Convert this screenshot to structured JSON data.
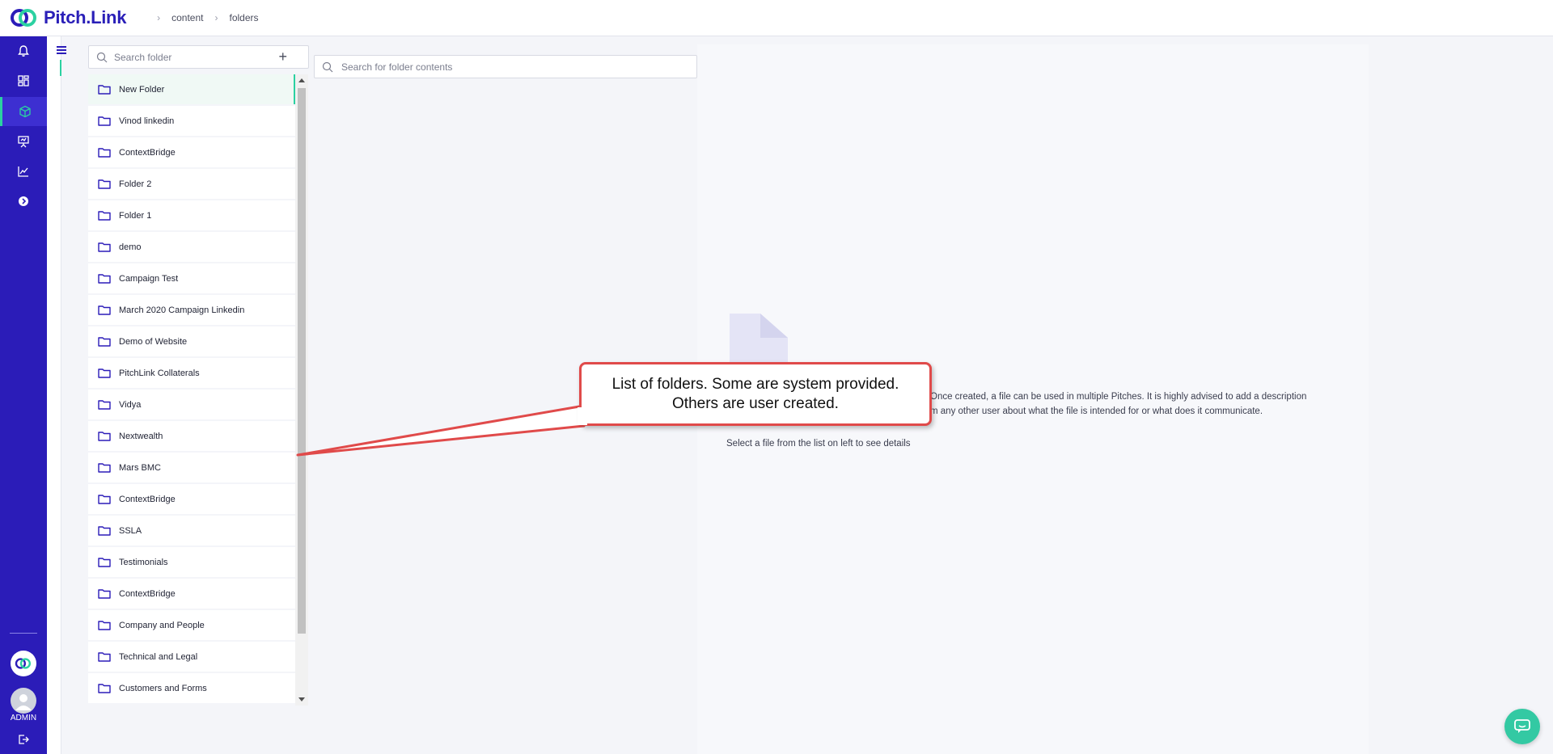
{
  "app": {
    "brand": "Pitch.Link",
    "colors": {
      "brand": "#2b1cb8",
      "accent": "#2bd1a1",
      "callout_border": "#e04a4a",
      "chat": "#33c9a3"
    }
  },
  "breadcrumb": {
    "items": [
      "content",
      "folders"
    ]
  },
  "rail": {
    "items": [
      "bell-icon",
      "dashboard-icon",
      "content-cube-icon",
      "presentation-icon",
      "analytics-icon",
      "arrow-circle-icon"
    ],
    "active_index": 2,
    "user_label": "ADMIN"
  },
  "folders": {
    "search_placeholder": "Search folder",
    "add_symbol": "+",
    "items": [
      "New Folder",
      "Vinod linkedin",
      "ContextBridge",
      "Folder 2",
      "Folder 1",
      "demo",
      "Campaign Test",
      "March 2020 Campaign Linkedin",
      "Demo of Website",
      "PitchLink Collaterals",
      "Vidya",
      "Nextwealth",
      "Mars BMC",
      "ContextBridge",
      "SSLA",
      "Testimonials",
      "ContextBridge",
      "Company and People",
      "Technical and Legal",
      "Customers and Forms"
    ],
    "selected_index": 0
  },
  "content": {
    "search_placeholder": "Search for folder contents"
  },
  "detail": {
    "description_line1": "Once created, a file can be used in multiple Pitches. It is highly advised to add a description",
    "description_line2": "m any other user about what the file is intended for or what does it communicate.",
    "hint": "Select a file from the list on left to see details"
  },
  "callout": {
    "text": "List of folders. Some are system provided. Others are user created."
  }
}
